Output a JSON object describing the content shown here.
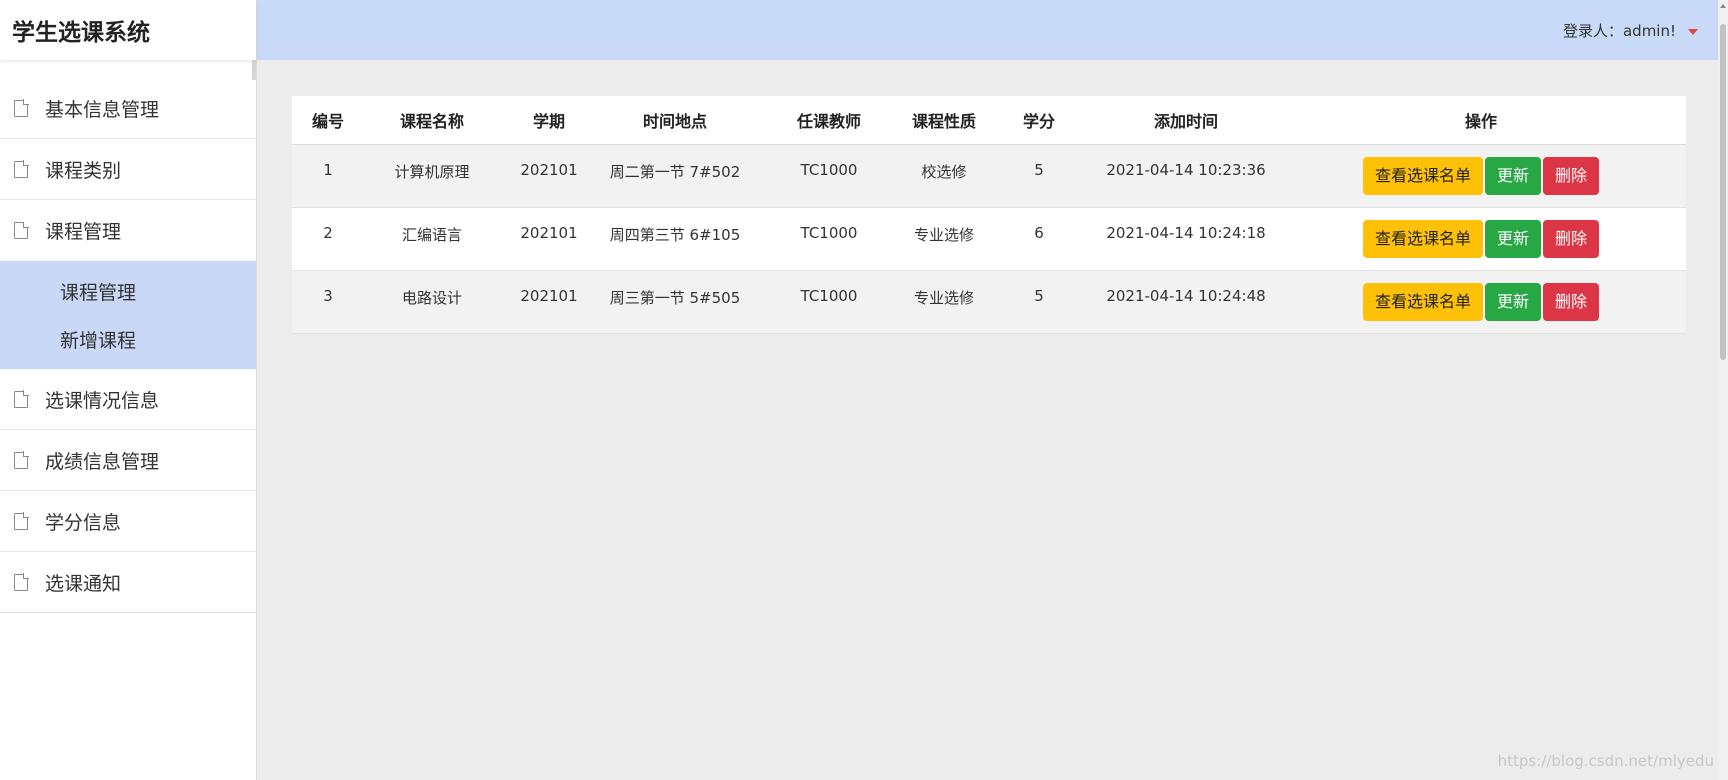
{
  "app": {
    "title": "学生选课系统"
  },
  "header": {
    "user_label": "登录人：admin!"
  },
  "sidebar": {
    "items": [
      {
        "label": "基本信息管理"
      },
      {
        "label": "课程类别"
      },
      {
        "label": "课程管理"
      },
      {
        "label": "选课情况信息"
      },
      {
        "label": "成绩信息管理"
      },
      {
        "label": "学分信息"
      },
      {
        "label": "选课通知"
      }
    ],
    "submenu": [
      {
        "label": "课程管理"
      },
      {
        "label": "新增课程"
      }
    ]
  },
  "table": {
    "headers": [
      "编号",
      "课程名称",
      "学期",
      "时间地点",
      "任课教师",
      "课程性质",
      "学分",
      "添加时间",
      "操作"
    ],
    "rows": [
      {
        "id": "1",
        "name": "计算机原理",
        "term": "202101",
        "time_place": "周二第一节 7#502",
        "teacher": "TC1000",
        "nature": "校选修",
        "credit": "5",
        "added": "2021-04-14 10:23:36"
      },
      {
        "id": "2",
        "name": "汇编语言",
        "term": "202101",
        "time_place": "周四第三节 6#105",
        "teacher": "TC1000",
        "nature": "专业选修",
        "credit": "6",
        "added": "2021-04-14 10:24:18"
      },
      {
        "id": "3",
        "name": "电路设计",
        "term": "202101",
        "time_place": "周三第一节 5#505",
        "teacher": "TC1000",
        "nature": "专业选修",
        "credit": "5",
        "added": "2021-04-14 10:24:48"
      }
    ],
    "actions": {
      "view": "查看选课名单",
      "update": "更新",
      "delete": "删除"
    }
  },
  "watermark": "https://blog.csdn.net/mlyedu",
  "colors": {
    "header_bg": "#c9d9f8",
    "submenu_bg": "#c9d8f7",
    "view_btn": "#ffc107",
    "update_btn": "#28a745",
    "delete_btn": "#dc3545"
  }
}
